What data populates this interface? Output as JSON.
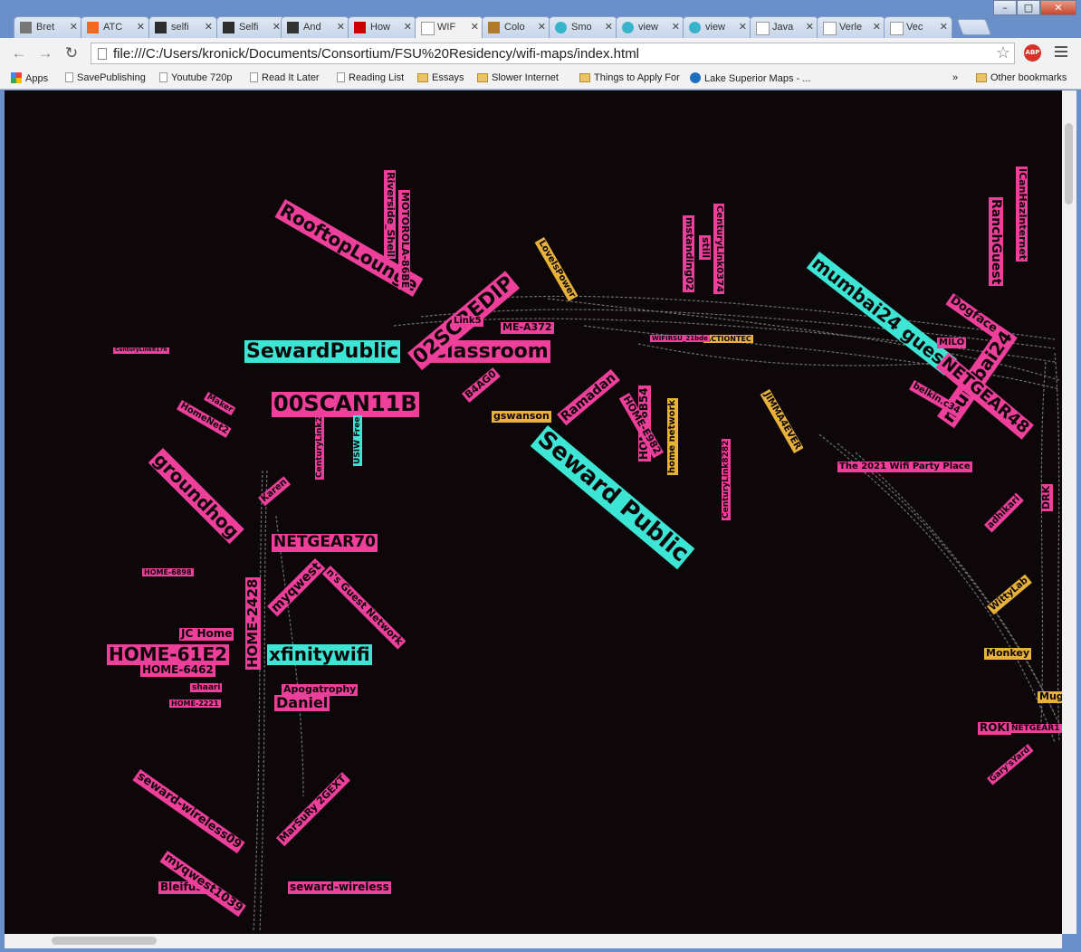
{
  "tabs": [
    {
      "icon": "bret-favicon-icon",
      "title": "Bret"
    },
    {
      "icon": "blogger-favicon-icon",
      "title": "ATC"
    },
    {
      "icon": "s-favicon-icon",
      "title": "selfi"
    },
    {
      "icon": "s-favicon-icon",
      "title": "Selfi"
    },
    {
      "icon": "lrb-favicon-icon",
      "title": "And"
    },
    {
      "icon": "n-favicon-icon",
      "title": "How"
    },
    {
      "icon": "page-favicon-icon",
      "title": "WIF",
      "active": true
    },
    {
      "icon": "palette-favicon-icon",
      "title": "Colo"
    },
    {
      "icon": "circle-favicon-icon",
      "title": "Smo"
    },
    {
      "icon": "circle-favicon-icon",
      "title": "view"
    },
    {
      "icon": "circle-favicon-icon",
      "title": "view"
    },
    {
      "icon": "page-favicon-icon",
      "title": "Java"
    },
    {
      "icon": "page-favicon-icon",
      "title": "Verle"
    },
    {
      "icon": "page-favicon-icon",
      "title": "Vec"
    }
  ],
  "toolbar": {
    "url": "file:///C:/Users/kronick/Documents/Consortium/FSU%20Residency/wifi-maps/index.html",
    "abp": "ABP"
  },
  "bookmarks": [
    {
      "icon": "grid",
      "label": "Apps"
    },
    {
      "icon": "page",
      "label": "SavePublishing"
    },
    {
      "icon": "page",
      "label": "Youtube 720p"
    },
    {
      "icon": "page",
      "label": "Read It Later"
    },
    {
      "icon": "page",
      "label": "Reading List"
    },
    {
      "icon": "folder",
      "label": "Essays"
    },
    {
      "icon": "folder",
      "label": "Slower Internet"
    },
    {
      "icon": "folder",
      "label": "Things to Apply For"
    },
    {
      "icon": "globe",
      "label": "Lake Superior Maps - ..."
    }
  ],
  "bookmarks_overflow": "»",
  "other_bookmarks": "Other bookmarks",
  "networks": [
    {
      "name": "SewardPublic",
      "color": "teal"
    },
    {
      "name": "Classroom",
      "color": "pink"
    },
    {
      "name": "00SCAN11B",
      "color": "pink"
    },
    {
      "name": "Seward Public",
      "color": "teal"
    },
    {
      "name": "mumbai24 guest",
      "color": "teal"
    },
    {
      "name": "RooftopLounge",
      "color": "pink"
    },
    {
      "name": "02SCREDIP",
      "color": "pink"
    },
    {
      "name": "groundhog",
      "color": "pink"
    },
    {
      "name": "NETGEAR70",
      "color": "pink"
    },
    {
      "name": "HOME-61E2",
      "color": "pink"
    },
    {
      "name": "xfinitywifi",
      "color": "teal"
    },
    {
      "name": "HOME-2428",
      "color": "pink"
    },
    {
      "name": "Daniel",
      "color": "pink"
    },
    {
      "name": "seward-wireless",
      "color": "pink"
    },
    {
      "name": "Bleifuss",
      "color": "pink"
    },
    {
      "name": "JC Home",
      "color": "pink"
    },
    {
      "name": "myqwest",
      "color": "pink"
    },
    {
      "name": "mumbai24",
      "color": "pink"
    },
    {
      "name": "NETGEAR48",
      "color": "pink"
    },
    {
      "name": "RanchGuest",
      "color": "pink"
    },
    {
      "name": "ICanHazInternet",
      "color": "pink"
    },
    {
      "name": "Dogface",
      "color": "pink"
    },
    {
      "name": "Monkey",
      "color": "gold"
    },
    {
      "name": "ROKI",
      "color": "pink"
    },
    {
      "name": "NETGEAR1",
      "color": "pink"
    },
    {
      "name": "gswanson",
      "color": "gold"
    },
    {
      "name": "Ramadan",
      "color": "pink"
    },
    {
      "name": "HOME-6B54",
      "color": "pink"
    },
    {
      "name": "home network",
      "color": "gold"
    },
    {
      "name": "CenturyLink8282",
      "color": "pink"
    },
    {
      "name": "The 2021 Wifi Party Place",
      "color": "pink"
    },
    {
      "name": "JIMMA4EVER",
      "color": "gold"
    },
    {
      "name": "ACTIONTEC",
      "color": "gold"
    },
    {
      "name": "MOTOROLA-86BE",
      "color": "pink"
    },
    {
      "name": "Riverside_Shell",
      "color": "pink"
    },
    {
      "name": "CenturyLink0374",
      "color": "pink"
    },
    {
      "name": "HOME-6898",
      "color": "pink"
    },
    {
      "name": "CenturyLink8176",
      "color": "pink"
    },
    {
      "name": "Mug",
      "color": "gold"
    },
    {
      "name": "WittyLab",
      "color": "gold"
    },
    {
      "name": "MarSuRy 2GEXT",
      "color": "pink"
    },
    {
      "name": "myqwest1039",
      "color": "pink"
    },
    {
      "name": "mstanding02",
      "color": "pink"
    },
    {
      "name": "still",
      "color": "pink"
    },
    {
      "name": "Karen",
      "color": "pink"
    },
    {
      "name": "HOME-E982",
      "color": "pink"
    },
    {
      "name": "belkin.c34",
      "color": "pink"
    },
    {
      "name": "adhikari",
      "color": "pink"
    },
    {
      "name": "seward-wireless09",
      "color": "pink"
    },
    {
      "name": "LoveIsPower",
      "color": "gold"
    },
    {
      "name": "Link5",
      "color": "pink"
    },
    {
      "name": "USIW Free",
      "color": "teal"
    },
    {
      "name": "Apogatrophy",
      "color": "pink"
    },
    {
      "name": "HomeNet2",
      "color": "pink"
    },
    {
      "name": "Maker",
      "color": "pink"
    },
    {
      "name": "HOME-6462",
      "color": "pink"
    },
    {
      "name": "shaari",
      "color": "pink"
    },
    {
      "name": "HOME-2221",
      "color": "pink"
    },
    {
      "name": "CenturyLink2",
      "color": "pink"
    },
    {
      "name": "ME-A372",
      "color": "pink"
    },
    {
      "name": "MILO",
      "color": "pink"
    },
    {
      "name": "DRK",
      "color": "pink"
    },
    {
      "name": "Gary'sYard",
      "color": "pink"
    },
    {
      "name": "n's Guest Network",
      "color": "pink"
    },
    {
      "name": "B4AG0",
      "color": "pink"
    },
    {
      "name": "WIFIRSU_21bde",
      "color": "pink"
    }
  ]
}
